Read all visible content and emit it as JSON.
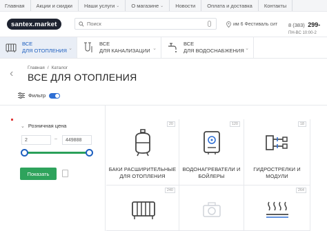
{
  "topnav": {
    "items": [
      "Главная",
      "Акции и скидки",
      "Наши услуги",
      "О магазине",
      "Новости",
      "Оплата и доставка",
      "Контакты"
    ]
  },
  "header": {
    "logo": "santex.market",
    "search_placeholder": "Поиск",
    "address": "им 6 Фестиваль сит",
    "phone_code": "8 (383)",
    "phone_number": "299-",
    "hours": "ПН-ВС 10:00-2"
  },
  "categories": [
    {
      "label_line1": "ВСЕ",
      "label_line2": "ДЛЯ ОТОПЛЕНИЯ",
      "icon": "radiator-icon",
      "active": true
    },
    {
      "label_line1": "ВСЕ",
      "label_line2": "ДЛЯ КАНАЛИЗАЦИИ",
      "icon": "pipes-icon",
      "active": false
    },
    {
      "label_line1": "ВСЕ",
      "label_line2": "ДЛЯ ВОДОСНАБЖЕНИЯ",
      "icon": "faucet-icon",
      "active": false
    }
  ],
  "breadcrumbs": [
    "Главная",
    "Каталог"
  ],
  "page_title": "ВСЕ ДЛЯ ОТОПЛЕНИЯ",
  "filter_label": "Фильтр",
  "filter_enabled": true,
  "price_filter": {
    "label": "Розничная цена",
    "min": "2",
    "max": "449888",
    "show_button": "Показать"
  },
  "products": [
    {
      "count": "20",
      "name_line1": "БАКИ РАСШИРИТЕЛЬНЫЕ",
      "name_line2": "ДЛЯ ОТОПЛЕНИЯ",
      "icon": "expansion-tank-icon"
    },
    {
      "count": "120",
      "name_line1": "ВОДОНАГРЕВАТЕЛИ И",
      "name_line2": "БОЙЛЕРЫ",
      "icon": "water-heater-icon"
    },
    {
      "count": "18",
      "name_line1": "ГИДРОСТРЕЛКИ И",
      "name_line2": "МОДУЛИ",
      "icon": "hydraulic-separator-icon"
    },
    {
      "count": "240",
      "name_line1": "",
      "name_line2": "",
      "icon": "radiator-icon"
    },
    {
      "count": "",
      "name_line1": "",
      "name_line2": "",
      "icon": "camera-placeholder-icon"
    },
    {
      "count": "264",
      "name_line1": "",
      "name_line2": "",
      "icon": "floor-heating-icon"
    }
  ],
  "colors": {
    "accent": "#1d5fbf",
    "green": "#2ea35c",
    "logo_bg": "#1e2330"
  }
}
